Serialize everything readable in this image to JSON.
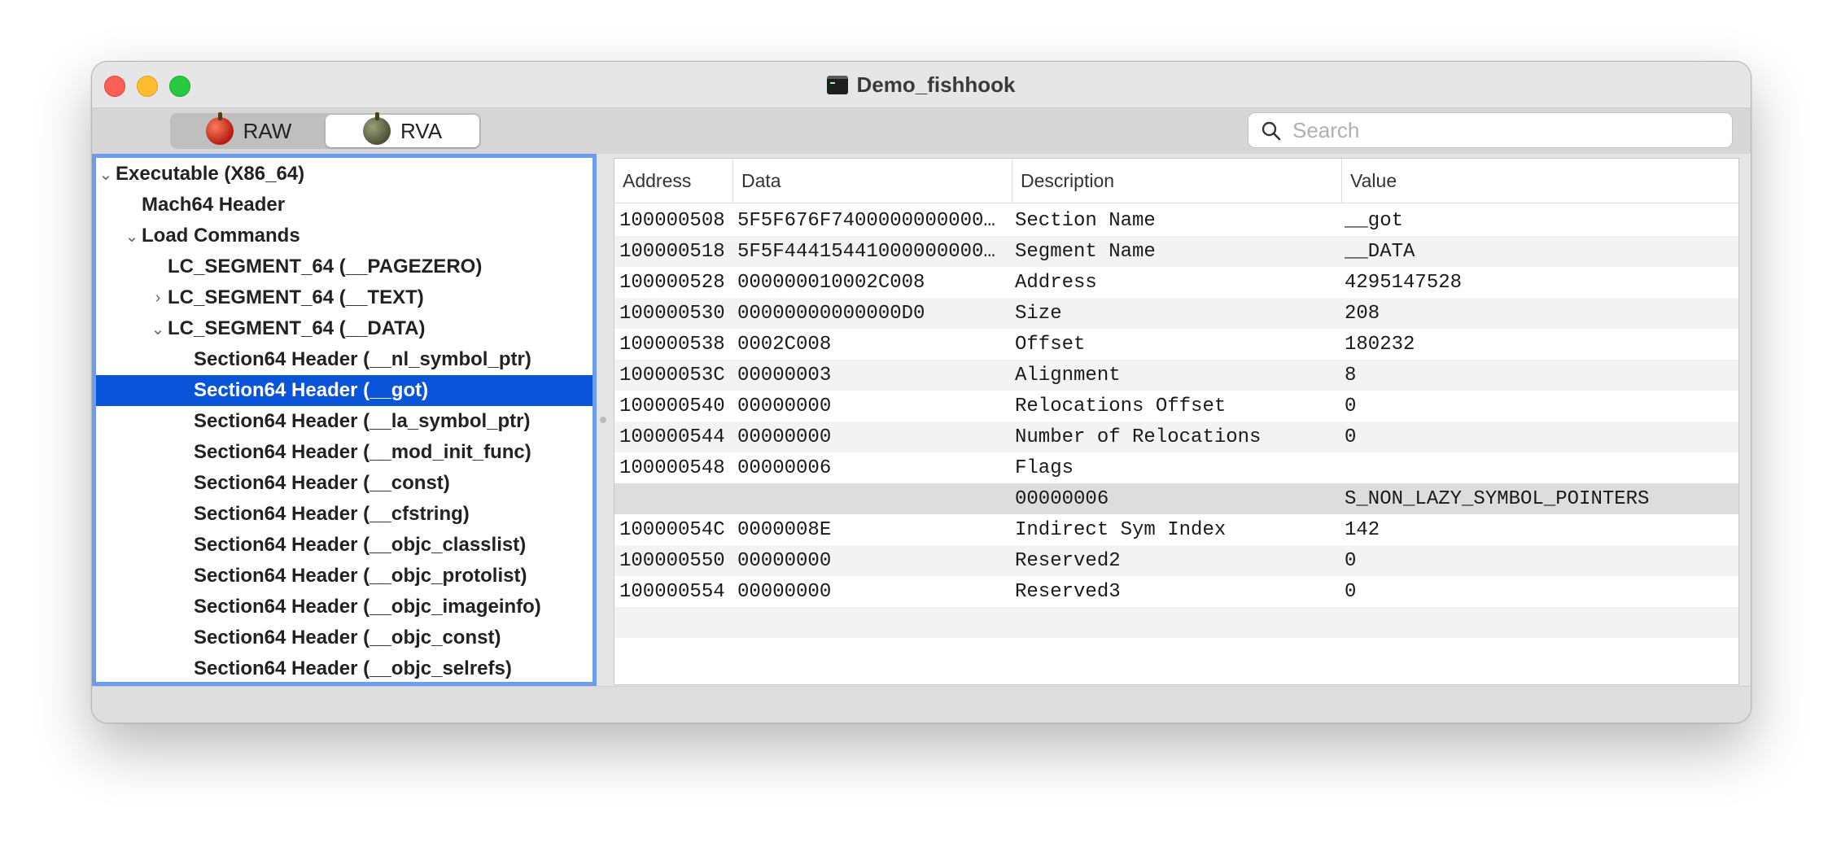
{
  "window": {
    "title": "Demo_fishhook"
  },
  "toolbar": {
    "modes": [
      {
        "label": "RAW",
        "selected": false
      },
      {
        "label": "RVA",
        "selected": true
      }
    ],
    "search_placeholder": "Search"
  },
  "tree": {
    "items": [
      {
        "label": "Executable  (X86_64)",
        "disclosure": "expanded"
      },
      {
        "label": "Mach64 Header",
        "disclosure": "none"
      },
      {
        "label": "Load Commands",
        "disclosure": "expanded"
      },
      {
        "label": "LC_SEGMENT_64 (__PAGEZERO)",
        "disclosure": "none"
      },
      {
        "label": "LC_SEGMENT_64 (__TEXT)",
        "disclosure": "collapsed"
      },
      {
        "label": "LC_SEGMENT_64 (__DATA)",
        "disclosure": "expanded"
      },
      {
        "label": "Section64 Header (__nl_symbol_ptr)",
        "disclosure": "none"
      },
      {
        "label": "Section64 Header (__got)",
        "disclosure": "none",
        "selected": true
      },
      {
        "label": "Section64 Header (__la_symbol_ptr)",
        "disclosure": "none"
      },
      {
        "label": "Section64 Header (__mod_init_func)",
        "disclosure": "none"
      },
      {
        "label": "Section64 Header (__const)",
        "disclosure": "none"
      },
      {
        "label": "Section64 Header (__cfstring)",
        "disclosure": "none"
      },
      {
        "label": "Section64 Header (__objc_classlist)",
        "disclosure": "none"
      },
      {
        "label": "Section64 Header (__objc_protolist)",
        "disclosure": "none"
      },
      {
        "label": "Section64 Header (__objc_imageinfo)",
        "disclosure": "none"
      },
      {
        "label": "Section64 Header (__objc_const)",
        "disclosure": "none"
      },
      {
        "label": "Section64 Header (__objc_selrefs)",
        "disclosure": "none"
      }
    ]
  },
  "table": {
    "columns": [
      "Address",
      "Data",
      "Description",
      "Value"
    ],
    "rows": [
      {
        "address": "100000508",
        "data": "5F5F676F7400000000000…",
        "description": "Section Name",
        "value": "__got"
      },
      {
        "address": "100000518",
        "data": "5F5F44415441000000000…",
        "description": "Segment Name",
        "value": "__DATA"
      },
      {
        "address": "100000528",
        "data": "000000010002C008",
        "description": "Address",
        "value": "4295147528"
      },
      {
        "address": "100000530",
        "data": "00000000000000D0",
        "description": "Size",
        "value": "208"
      },
      {
        "address": "100000538",
        "data": "0002C008",
        "description": "Offset",
        "value": "180232"
      },
      {
        "address": "10000053C",
        "data": "00000003",
        "description": "Alignment",
        "value": "8"
      },
      {
        "address": "100000540",
        "data": "00000000",
        "description": "Relocations Offset",
        "value": "0"
      },
      {
        "address": "100000544",
        "data": "00000000",
        "description": "Number of Relocations",
        "value": "0"
      },
      {
        "address": "100000548",
        "data": "00000006",
        "description": "Flags",
        "value": ""
      },
      {
        "address": "",
        "data": "",
        "description": "00000006",
        "value": "S_NON_LAZY_SYMBOL_POINTERS",
        "sub": true
      },
      {
        "address": "10000054C",
        "data": "0000008E",
        "description": "Indirect Sym Index",
        "value": "142"
      },
      {
        "address": "100000550",
        "data": "00000000",
        "description": "Reserved2",
        "value": "0"
      },
      {
        "address": "100000554",
        "data": "00000000",
        "description": "Reserved3",
        "value": "0"
      }
    ]
  },
  "colors": {
    "selection": "#0a54d9",
    "focus_ring": "#6b9cf0",
    "close": "#fe5f57",
    "minimize": "#febc2e",
    "zoom": "#28c840"
  }
}
